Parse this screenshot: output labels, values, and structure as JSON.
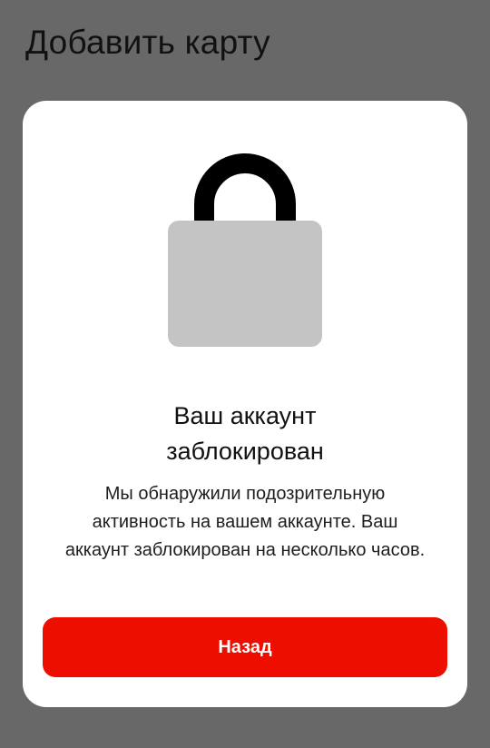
{
  "header": {
    "title": "Добавить карту"
  },
  "modal": {
    "icon": "lock-icon",
    "title_lines": [
      "Ваш аккаунт",
      "заблокирован"
    ],
    "message": "Мы обнаружили подозрительную активность на вашем аккаунте. Ваш аккаунт заблокирован на несколько часов.",
    "back_label": "Назад"
  },
  "colors": {
    "overlay": "#686868",
    "card": "#ffffff",
    "lock_body": "#c4c4c4",
    "lock_shackle": "#000000",
    "button": "#ee0e00",
    "button_text": "#ffffff"
  }
}
